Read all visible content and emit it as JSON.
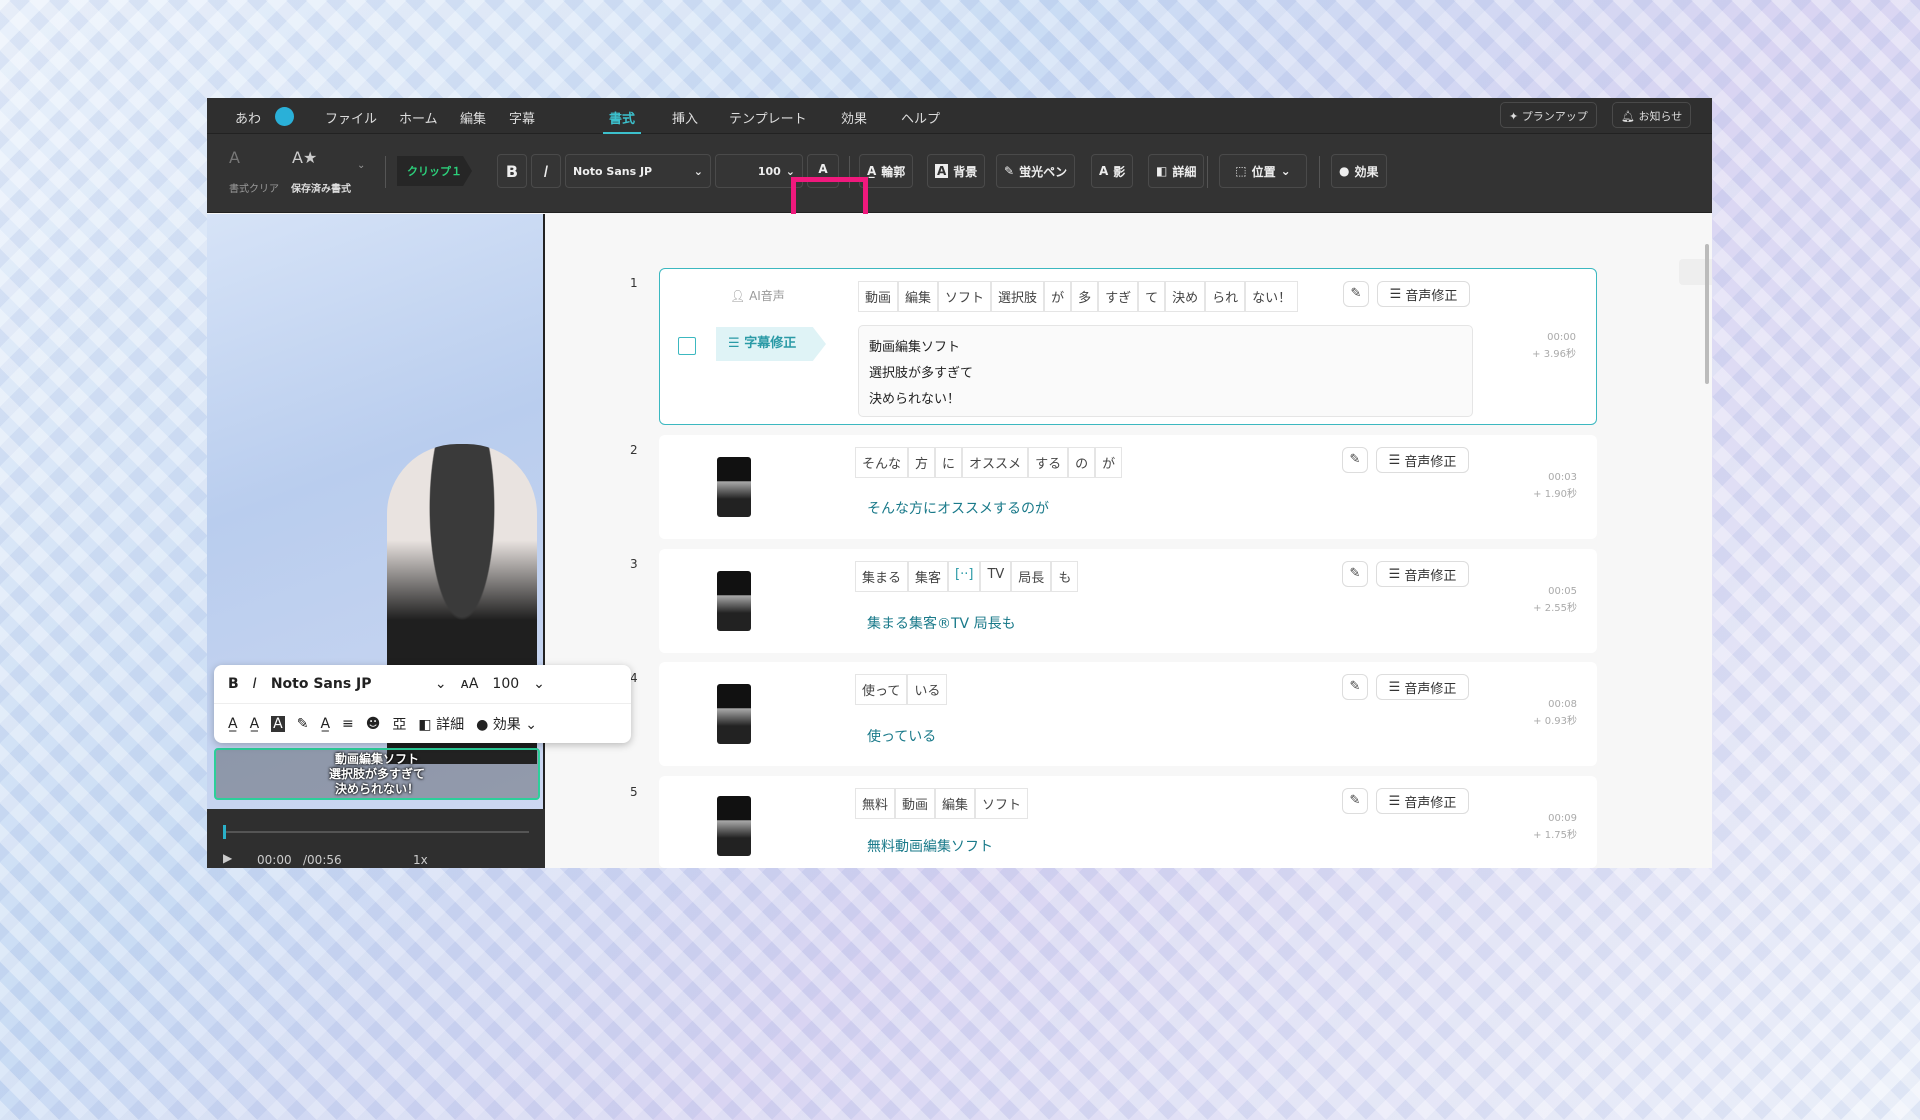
{
  "menu": {
    "user": "あわ",
    "items": [
      "ファイル",
      "ホーム",
      "編集",
      "字幕",
      "書式",
      "挿入",
      "テンプレート",
      "効果",
      "ヘルプ"
    ],
    "active": "書式",
    "plan_up": "プランアップ",
    "notice": "お知らせ"
  },
  "toolbar": {
    "clear_format": "書式クリア",
    "saved_format": "保存済み書式",
    "clip": "クリップ１",
    "bold": "B",
    "italic": "I",
    "font": "Noto Sans JP",
    "size": "100",
    "outline": "輪郭",
    "background": "背景",
    "highlighter": "蛍光ペン",
    "shadow": "影",
    "detail": "詳細",
    "position": "位置",
    "effect": "効果"
  },
  "float_toolbar": {
    "bold": "B",
    "italic": "I",
    "font": "Noto Sans JP",
    "size": "100",
    "detail": "詳細",
    "effect": "効果"
  },
  "preview": {
    "subtitle": [
      "動画編集ソフト",
      "選択肢が多すぎて",
      "決められない！"
    ],
    "time": "00:00",
    "duration": "/00:56",
    "speed": "1x"
  },
  "accent": "#3cb8c0",
  "rows": [
    {
      "num": "1",
      "ai_voice": "AI音声",
      "fix_label": "字幕修正",
      "words": [
        "動画",
        "編集",
        "ソフト",
        "選択肢",
        "が",
        "多",
        "すぎ",
        "て",
        "決め",
        "られ",
        "ない！"
      ],
      "subtitle": [
        "動画編集ソフト",
        "選択肢が多すぎて",
        "決められない！"
      ],
      "time": "00:00",
      "dur": "+ 3.96秒"
    },
    {
      "num": "2",
      "words": [
        "そんな",
        "方",
        "に",
        "オススメ",
        "する",
        "の",
        "が"
      ],
      "subtitle": [
        "そんな方にオススメするのが"
      ],
      "time": "00:03",
      "dur": "+ 1.90秒"
    },
    {
      "num": "3",
      "words": [
        "集まる",
        "集客",
        "[··]",
        "TV",
        "局長",
        "も"
      ],
      "subtitle": [
        "集まる集客®TV 局長も"
      ],
      "time": "00:05",
      "dur": "+ 2.55秒"
    },
    {
      "num": "4",
      "words": [
        "使って",
        "いる"
      ],
      "subtitle": [
        "使っている"
      ],
      "time": "00:08",
      "dur": "+ 0.93秒"
    },
    {
      "num": "5",
      "words": [
        "無料",
        "動画",
        "編集",
        "ソフト"
      ],
      "subtitle": [
        "無料動画編集ソフト"
      ],
      "time": "00:09",
      "dur": "+ 1.75秒"
    }
  ],
  "voice_fix": "音声修正"
}
